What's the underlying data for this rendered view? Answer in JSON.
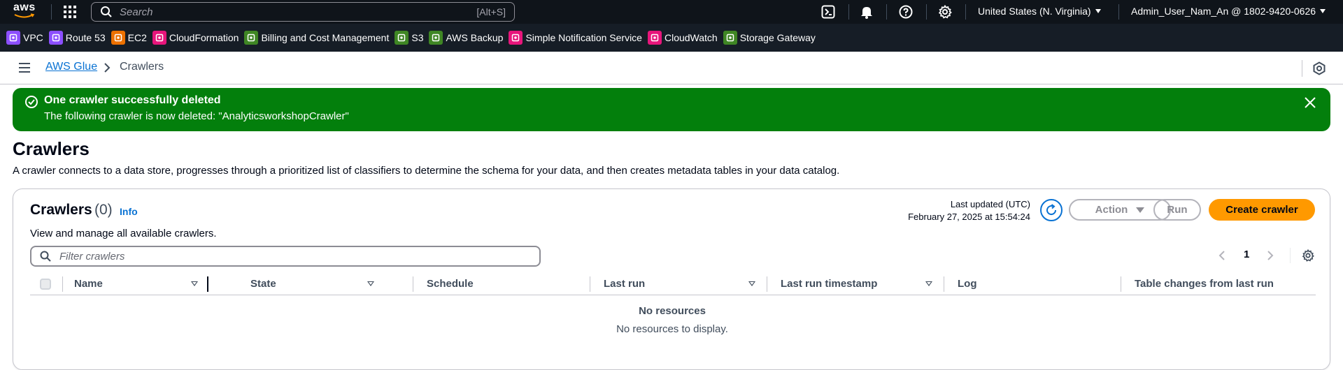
{
  "topbar": {
    "logo_text": "aws",
    "search_placeholder": "Search",
    "search_shortcut": "[Alt+S]",
    "region": "United States (N. Virginia)",
    "account": "Admin_User_Nam_An @ 1802-9420-0626",
    "icons": [
      "cloudshell-icon",
      "bell-icon",
      "help-icon",
      "gear-icon"
    ]
  },
  "favorites": [
    {
      "label": "VPC",
      "color": "#8c4fff"
    },
    {
      "label": "Route 53",
      "color": "#8c4fff"
    },
    {
      "label": "EC2",
      "color": "#ed7100"
    },
    {
      "label": "CloudFormation",
      "color": "#e7157b"
    },
    {
      "label": "Billing and Cost Management",
      "color": "#3f8624"
    },
    {
      "label": "S3",
      "color": "#3f8624"
    },
    {
      "label": "AWS Backup",
      "color": "#3f8624"
    },
    {
      "label": "Simple Notification Service",
      "color": "#e7157b"
    },
    {
      "label": "CloudWatch",
      "color": "#e7157b"
    },
    {
      "label": "Storage Gateway",
      "color": "#3f8624"
    }
  ],
  "breadcrumb": {
    "parent": "AWS Glue",
    "current": "Crawlers"
  },
  "flash": {
    "title": "One crawler successfully deleted",
    "message": "The following crawler is now deleted: \"AnalyticsworkshopCrawler\"",
    "color": "#037f0c"
  },
  "page": {
    "title": "Crawlers",
    "description": "A crawler connects to a data store, progresses through a prioritized list of classifiers to determine the schema for your data, and then creates metadata tables in your data catalog."
  },
  "panel": {
    "title": "Crawlers",
    "count": "(0)",
    "info": "Info",
    "subtitle": "View and manage all available crawlers.",
    "last_updated_label": "Last updated (UTC)",
    "last_updated_value": "February 27, 2025 at 15:54:24",
    "action_label": "Action",
    "run_label": "Run",
    "create_label": "Create crawler",
    "accent_color": "#ff9900",
    "filter_placeholder": "Filter crawlers",
    "page_number": "1",
    "columns": [
      "Name",
      "State",
      "Schedule",
      "Last run",
      "Last run timestamp",
      "Log",
      "Table changes from last run"
    ],
    "empty_title": "No resources",
    "empty_message": "No resources to display."
  }
}
